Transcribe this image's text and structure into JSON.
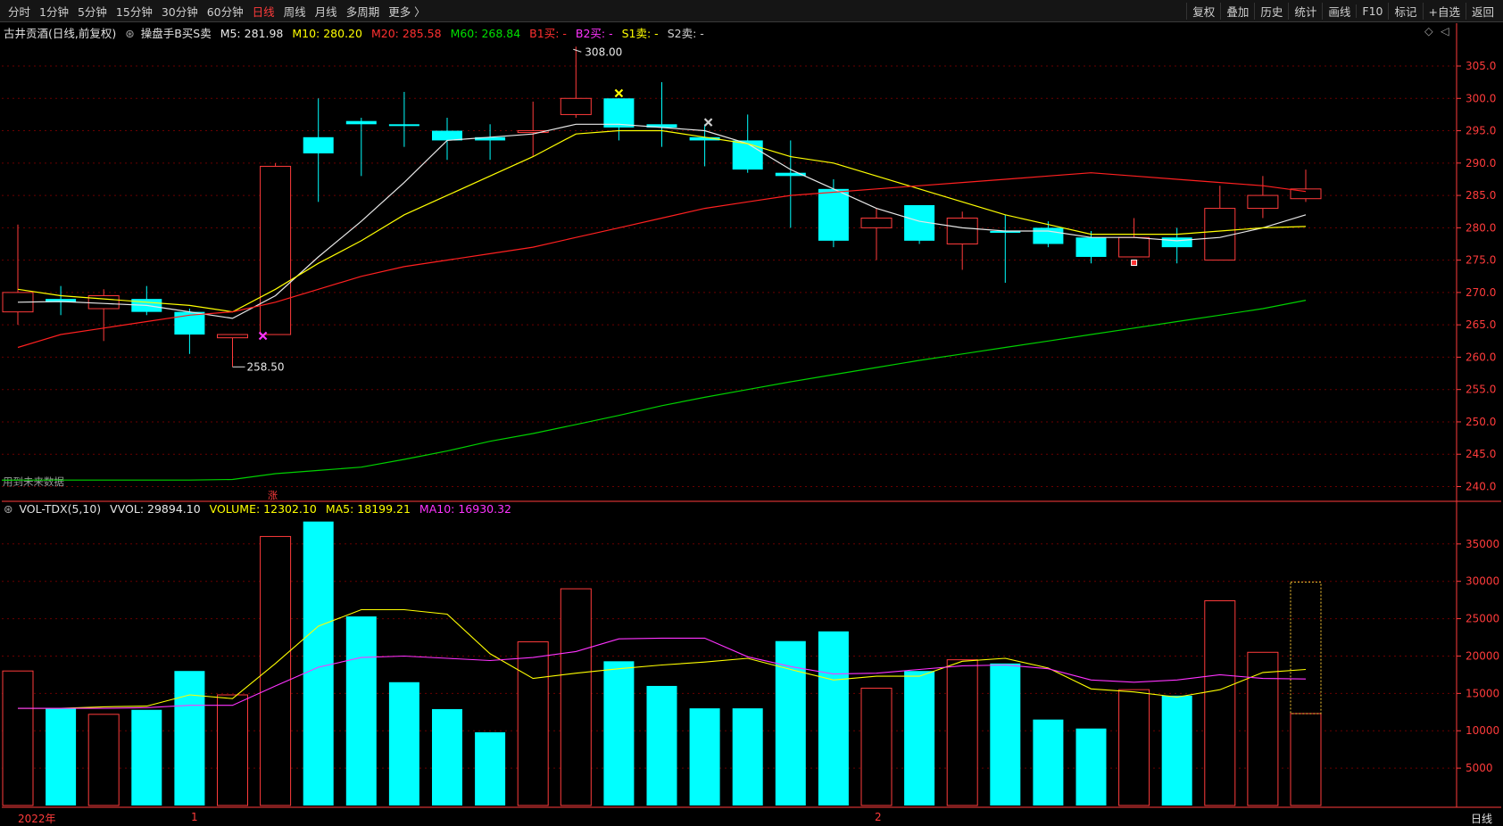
{
  "topbar": {
    "menu": [
      "分时",
      "1分钟",
      "5分钟",
      "15分钟",
      "30分钟",
      "60分钟",
      "日线",
      "周线",
      "月线",
      "多周期",
      "更多 〉"
    ],
    "active": "日线",
    "tools": [
      "复权",
      "叠加",
      "历史",
      "统计",
      "画线",
      "F10",
      "标记",
      "+自选",
      "返回"
    ]
  },
  "price_panel": {
    "stock": "古井贡酒(日线,前复权)",
    "indicator": "操盘手B买S卖",
    "m5": "M5: 281.98",
    "m10": "M10: 280.20",
    "m20": "M20: 285.58",
    "m60": "M60: 268.84",
    "b1": "B1买: -",
    "b2": "B2买: -",
    "s1": "S1卖: -",
    "s2": "S2卖: -",
    "high_label": "308.00",
    "low_label": "258.50",
    "note": "用到未来数据",
    "marker": "涨"
  },
  "vol_panel": {
    "name": "VOL-TDX(5,10)",
    "vvol": "VVOL: 29894.10",
    "volume": "VOLUME: 12302.10",
    "ma5": "MA5: 18199.21",
    "ma10": "MA10: 16930.32"
  },
  "bottom": {
    "year": "2022年",
    "m1": "1",
    "m2": "2",
    "period": "日线"
  },
  "colors": {
    "up": "#ff3b3b",
    "down": "#00ffff",
    "m5": "#e8e8e8",
    "m10": "#ffff00",
    "m20": "#ff2020",
    "m60": "#00d000",
    "magenta": "#ff33ff",
    "axis": "#ff3b3b"
  },
  "chart_data": [
    {
      "type": "candlestick",
      "title": "古井贡酒(日线,前复权)",
      "y_ticks": [
        240,
        245,
        250,
        255,
        260,
        265,
        270,
        275,
        280,
        285,
        290,
        295,
        300,
        305
      ],
      "ylim": [
        238,
        309
      ],
      "candles": [
        {
          "o": 267.0,
          "h": 280.5,
          "l": 265.0,
          "c": 270.0,
          "up": true
        },
        {
          "o": 269.0,
          "h": 271.0,
          "l": 266.5,
          "c": 268.5,
          "up": false
        },
        {
          "o": 267.5,
          "h": 270.5,
          "l": 262.5,
          "c": 269.5,
          "up": true
        },
        {
          "o": 269.0,
          "h": 271.0,
          "l": 266.5,
          "c": 267.0,
          "up": false
        },
        {
          "o": 267.0,
          "h": 267.5,
          "l": 260.5,
          "c": 263.5,
          "up": false
        },
        {
          "o": 263.0,
          "h": 263.5,
          "l": 258.5,
          "c": 263.5,
          "up": true
        },
        {
          "o": 263.5,
          "h": 290.0,
          "l": 263.5,
          "c": 289.5,
          "up": true
        },
        {
          "o": 294.0,
          "h": 300.0,
          "l": 284.0,
          "c": 291.5,
          "up": false
        },
        {
          "o": 296.5,
          "h": 297.0,
          "l": 288.0,
          "c": 296.0,
          "up": false
        },
        {
          "o": 296.0,
          "h": 301.0,
          "l": 292.5,
          "c": 296.0,
          "up": false
        },
        {
          "o": 295.0,
          "h": 297.0,
          "l": 290.5,
          "c": 293.5,
          "up": false
        },
        {
          "o": 294.0,
          "h": 296.0,
          "l": 290.5,
          "c": 293.5,
          "up": false
        },
        {
          "o": 295.0,
          "h": 299.5,
          "l": 291.0,
          "c": 295.0,
          "up": true
        },
        {
          "o": 297.5,
          "h": 308.0,
          "l": 297.0,
          "c": 300.0,
          "up": true
        },
        {
          "o": 300.0,
          "h": 300.0,
          "l": 293.5,
          "c": 295.5,
          "up": false
        },
        {
          "o": 296.0,
          "h": 302.5,
          "l": 292.5,
          "c": 295.5,
          "up": false
        },
        {
          "o": 294.0,
          "h": 296.0,
          "l": 289.5,
          "c": 293.5,
          "up": false
        },
        {
          "o": 293.5,
          "h": 297.5,
          "l": 288.5,
          "c": 289.0,
          "up": false
        },
        {
          "o": 288.5,
          "h": 293.5,
          "l": 280.0,
          "c": 288.0,
          "up": false
        },
        {
          "o": 286.0,
          "h": 287.5,
          "l": 277.0,
          "c": 278.0,
          "up": false
        },
        {
          "o": 280.0,
          "h": 283.0,
          "l": 275.0,
          "c": 281.5,
          "up": true
        },
        {
          "o": 283.5,
          "h": 283.5,
          "l": 277.5,
          "c": 278.0,
          "up": false
        },
        {
          "o": 277.5,
          "h": 282.5,
          "l": 273.5,
          "c": 281.5,
          "up": true
        },
        {
          "o": 279.5,
          "h": 282.0,
          "l": 271.5,
          "c": 279.5,
          "up": false
        },
        {
          "o": 280.0,
          "h": 281.0,
          "l": 277.0,
          "c": 277.5,
          "up": false
        },
        {
          "o": 278.5,
          "h": 279.5,
          "l": 274.5,
          "c": 275.5,
          "up": false
        },
        {
          "o": 275.5,
          "h": 281.5,
          "l": 275.5,
          "c": 278.5,
          "up": true
        },
        {
          "o": 278.5,
          "h": 280.0,
          "l": 274.5,
          "c": 277.0,
          "up": false
        },
        {
          "o": 275.0,
          "h": 286.5,
          "l": 275.0,
          "c": 283.0,
          "up": true
        },
        {
          "o": 283.0,
          "h": 288.0,
          "l": 281.5,
          "c": 285.0,
          "up": true
        },
        {
          "o": 284.5,
          "h": 289.0,
          "l": 284.0,
          "c": 286.0,
          "up": true
        }
      ],
      "series": [
        {
          "name": "M5",
          "values": [
            268.5,
            268.6,
            268.3,
            268.0,
            267.0,
            266.0,
            269.5,
            275.5,
            281.0,
            287.0,
            293.5,
            294.0,
            294.5,
            296.0,
            296.0,
            295.5,
            295.0,
            293.0,
            289.0,
            286.0,
            283.0,
            281.0,
            280.0,
            279.5,
            279.5,
            278.5,
            278.5,
            278.0,
            278.5,
            280.0,
            282.0
          ]
        },
        {
          "name": "M10",
          "values": [
            270.5,
            269.5,
            269.0,
            268.5,
            268.0,
            267.0,
            270.5,
            274.5,
            278.0,
            282.0,
            285.0,
            288.0,
            291.0,
            294.5,
            295.0,
            295.0,
            294.0,
            293.0,
            291.0,
            290.0,
            288.0,
            286.0,
            284.0,
            282.0,
            280.5,
            279.0,
            279.0,
            279.0,
            279.5,
            280.0,
            280.2
          ]
        },
        {
          "name": "M20",
          "values": [
            261.5,
            263.5,
            264.5,
            265.5,
            266.5,
            267.0,
            268.5,
            270.5,
            272.5,
            274.0,
            275.0,
            276.0,
            277.0,
            278.5,
            280.0,
            281.5,
            283.0,
            284.0,
            285.0,
            285.5,
            286.0,
            286.5,
            287.0,
            287.5,
            288.0,
            288.5,
            288.0,
            287.5,
            287.0,
            286.5,
            285.6
          ]
        },
        {
          "name": "M60",
          "values": [
            241.0,
            241.0,
            241.0,
            241.0,
            241.0,
            241.1,
            242.0,
            242.5,
            243.0,
            244.2,
            245.5,
            247.0,
            248.2,
            249.6,
            251.0,
            252.5,
            253.8,
            255.0,
            256.2,
            257.3,
            258.4,
            259.5,
            260.5,
            261.5,
            262.5,
            263.5,
            264.5,
            265.5,
            266.5,
            267.5,
            268.8
          ]
        }
      ]
    },
    {
      "type": "bar",
      "title": "VOL-TDX(5,10)",
      "y_ticks": [
        5000,
        10000,
        15000,
        20000,
        25000,
        30000,
        35000
      ],
      "ylim": [
        0,
        38200
      ],
      "values": [
        18000,
        13000,
        12200,
        12800,
        18000,
        14800,
        36000,
        38000,
        25300,
        16500,
        12900,
        9800,
        21900,
        29000,
        19300,
        16000,
        13000,
        13000,
        22000,
        23300,
        15700,
        18000,
        19500,
        19000,
        11500,
        10300,
        15500,
        14700,
        27400,
        20500,
        12302
      ],
      "up": [
        true,
        false,
        true,
        false,
        false,
        true,
        true,
        false,
        false,
        false,
        false,
        false,
        true,
        true,
        false,
        false,
        false,
        false,
        false,
        false,
        true,
        false,
        true,
        false,
        false,
        false,
        true,
        false,
        true,
        true,
        true
      ],
      "series": [
        {
          "name": "MA5",
          "values": [
            13000,
            13000,
            13200,
            13300,
            14800,
            14300,
            19000,
            24000,
            26200,
            26200,
            25600,
            20300,
            17000,
            17700,
            18300,
            18800,
            19200,
            19700,
            18200,
            16800,
            17300,
            17300,
            19300,
            19700,
            18400,
            15600,
            15200,
            14500,
            15500,
            17800,
            18199
          ]
        },
        {
          "name": "MA10",
          "values": [
            13000,
            13000,
            13000,
            13100,
            13400,
            13400,
            16000,
            18500,
            19800,
            20000,
            19700,
            19400,
            19800,
            20600,
            22300,
            22400,
            22400,
            19900,
            18600,
            17600,
            17700,
            18200,
            18700,
            18800,
            18300,
            16800,
            16500,
            16800,
            17500,
            17000,
            16930
          ]
        }
      ]
    }
  ]
}
